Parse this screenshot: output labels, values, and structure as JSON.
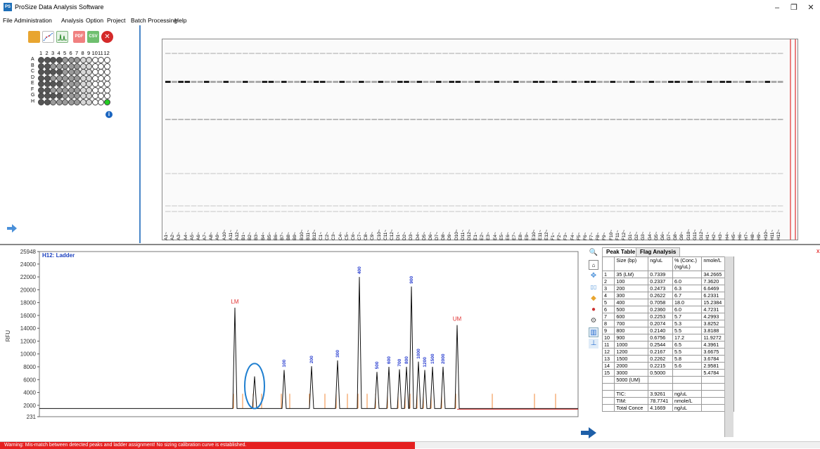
{
  "window": {
    "title": "ProSize Data Analysis Software",
    "icon_label": "PS",
    "minimize": "–",
    "restore": "❐",
    "close": "✕"
  },
  "menu": [
    "File",
    "Administration",
    "Analysis",
    "Option",
    "Project",
    "Batch Processing",
    "Help"
  ],
  "toolbar": {
    "icons": [
      "open-folder-icon",
      "sizing-curve-icon",
      "gel-view-icon",
      "pdf-export-icon",
      "csv-export-icon",
      "close-red-icon"
    ],
    "icon_labels": [
      "",
      "",
      "",
      "PDF",
      "CSV",
      "✕"
    ]
  },
  "plate": {
    "columns": [
      "1",
      "2",
      "3",
      "4",
      "5",
      "6",
      "7",
      "8",
      "9",
      "10",
      "11",
      "12"
    ],
    "rows": [
      "A",
      "B",
      "C",
      "D",
      "E",
      "F",
      "G",
      "H"
    ],
    "info_label": "i",
    "colors": {
      "dark": "#555555",
      "mid": "#9a9a9a",
      "light": "#d8d8d8",
      "empty": "#ffffff",
      "selected": "#22cc22"
    }
  },
  "gel": {
    "lanes": [
      "A1",
      "A2",
      "A3",
      "A4",
      "A5",
      "A6",
      "A7",
      "A8",
      "A9",
      "A10",
      "A11",
      "A12",
      "B1",
      "B2",
      "B3",
      "B4",
      "B5",
      "B6",
      "B7",
      "B8",
      "B9",
      "B10",
      "B11",
      "B12",
      "C1",
      "C2",
      "C3",
      "C4",
      "C5",
      "C6",
      "C7",
      "C8",
      "C9",
      "C10",
      "C11",
      "C12",
      "D1",
      "D2",
      "D3",
      "D4",
      "D5",
      "D6",
      "D7",
      "D8",
      "D9",
      "D10",
      "D11",
      "D12",
      "E1",
      "E2",
      "E3",
      "E4",
      "E5",
      "E6",
      "E7",
      "E8",
      "E9",
      "E10",
      "E11",
      "E12",
      "F1",
      "F2",
      "F3",
      "F4",
      "F5",
      "F6",
      "F7",
      "F8",
      "F9",
      "F10",
      "F11",
      "F12",
      "G1",
      "G2",
      "G3",
      "G4",
      "G5",
      "G6",
      "G7",
      "G8",
      "G9",
      "G10",
      "G11",
      "G12",
      "H1",
      "H2",
      "H3",
      "H4",
      "H5",
      "H6",
      "H7",
      "H8",
      "H9",
      "H10",
      "H11",
      "H12"
    ]
  },
  "electropherogram": {
    "title": "H12: Ladder",
    "ylabel": "RFU",
    "yticks": [
      "25948",
      "24000",
      "22000",
      "20000",
      "18000",
      "16000",
      "14000",
      "12000",
      "10000",
      "8000",
      "6000",
      "4000",
      "2000",
      "231"
    ],
    "peak_labels": [
      "LM",
      "100",
      "200",
      "300",
      "400",
      "500",
      "600",
      "700",
      "800",
      "900",
      "1000",
      "1200",
      "1500",
      "2000",
      "UM"
    ]
  },
  "chart_data": {
    "type": "line",
    "title": "H12: Ladder",
    "xlabel": "",
    "ylabel": "RFU",
    "ylim": [
      231,
      25948
    ],
    "peaks": [
      {
        "label": "LM",
        "value": 17200
      },
      {
        "label": "",
        "value": 6500
      },
      {
        "label": "100",
        "value": 7500
      },
      {
        "label": "200",
        "value": 8100
      },
      {
        "label": "300",
        "value": 9000
      },
      {
        "label": "400",
        "value": 22000
      },
      {
        "label": "500",
        "value": 7200
      },
      {
        "label": "600",
        "value": 8000
      },
      {
        "label": "700",
        "value": 7600
      },
      {
        "label": "800",
        "value": 8000
      },
      {
        "label": "900",
        "value": 20500
      },
      {
        "label": "1000",
        "value": 8800
      },
      {
        "label": "1200",
        "value": 7500
      },
      {
        "label": "1500",
        "value": 8000
      },
      {
        "label": "2000",
        "value": 8000
      },
      {
        "label": "UM",
        "value": 14500
      }
    ]
  },
  "peak_table": {
    "tabs": [
      "Peak Table",
      "Flag Analysis"
    ],
    "headers": [
      "",
      "Size (bp)",
      "ng/uL",
      "% (Conc.) (ng/uL)",
      "nmole/L"
    ],
    "rows": [
      [
        "1",
        "35 (LM)",
        "0.7339",
        "",
        "34.2665"
      ],
      [
        "2",
        "100",
        "0.2337",
        "6.0",
        "7.3620"
      ],
      [
        "3",
        "200",
        "0.2473",
        "6.3",
        "6.6469"
      ],
      [
        "4",
        "300",
        "0.2622",
        "6.7",
        "6.2331"
      ],
      [
        "5",
        "400",
        "0.7058",
        "18.0",
        "15.2384"
      ],
      [
        "6",
        "500",
        "0.2360",
        "6.0",
        "4.7231"
      ],
      [
        "7",
        "600",
        "0.2253",
        "5.7",
        "4.2993"
      ],
      [
        "8",
        "700",
        "0.2074",
        "5.3",
        "3.8252"
      ],
      [
        "9",
        "800",
        "0.2140",
        "5.5",
        "3.8188"
      ],
      [
        "10",
        "900",
        "0.6756",
        "17.2",
        "11.9272"
      ],
      [
        "11",
        "1000",
        "0.2544",
        "6.5",
        "4.3961"
      ],
      [
        "12",
        "1200",
        "0.2167",
        "5.5",
        "3.6675"
      ],
      [
        "13",
        "1500",
        "0.2262",
        "5.8",
        "3.6784"
      ],
      [
        "14",
        "2000",
        "0.2215",
        "5.6",
        "2.9581"
      ],
      [
        "15",
        "3000",
        "0.5000",
        "",
        "5.4784"
      ],
      [
        "",
        "5000 (UM)",
        "",
        "",
        ""
      ],
      [
        "",
        "",
        "",
        "",
        ""
      ],
      [
        "",
        "TIC:",
        "3.9261",
        "ng/uL",
        ""
      ],
      [
        "",
        "TIM:",
        "78.7741",
        "nmole/L",
        ""
      ],
      [
        "",
        "Total Conce",
        "4.1669",
        "ng/uL",
        ""
      ]
    ],
    "close_label": "x"
  },
  "status": {
    "warning": "Warning: Mis-match between detected peaks and ladder assignment! No sizing calibration curve is established."
  }
}
